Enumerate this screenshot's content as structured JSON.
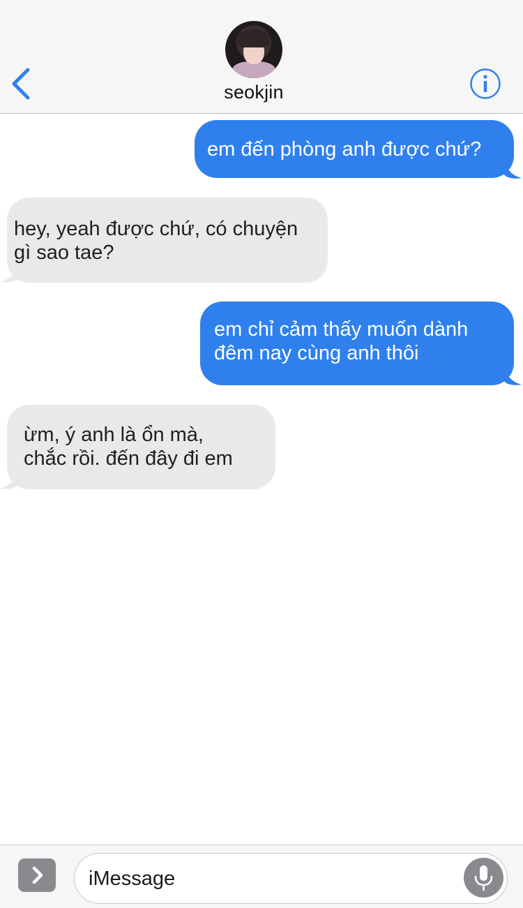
{
  "header": {
    "contact_name": "seokjin",
    "back_icon": "chevron-left-icon",
    "info_icon": "info-icon",
    "accent_color": "#2f80ed"
  },
  "messages": [
    {
      "direction": "sent",
      "text": "em đến phòng anh được chứ?"
    },
    {
      "direction": "received",
      "text": "hey, yeah được chứ, có chuyện\ngì sao tae?"
    },
    {
      "direction": "sent",
      "text": "em chỉ cảm thấy muốn dành\nđêm nay cùng anh thôi"
    },
    {
      "direction": "received",
      "text": "ừm, ý anh là ổn mà,\nchắc rồi. đến đây đi em"
    }
  ],
  "composer": {
    "placeholder": "iMessage",
    "apps_icon": "chevron-right-icon",
    "mic_icon": "microphone-icon"
  },
  "colors": {
    "sent_bubble": "#2f80ed",
    "received_bubble": "#e9e9eb",
    "header_bg": "#f6f6f6"
  }
}
